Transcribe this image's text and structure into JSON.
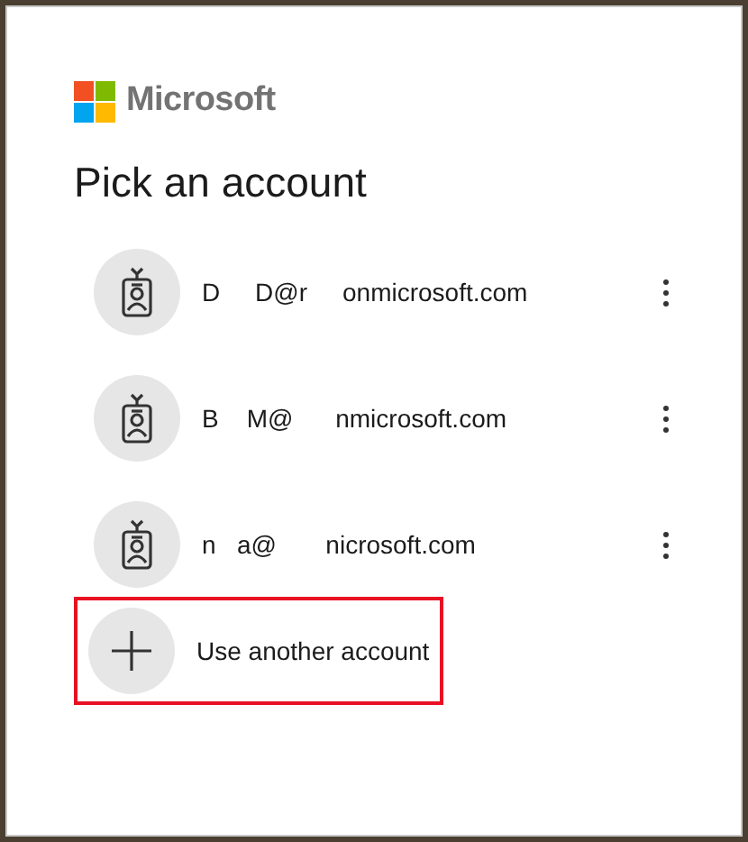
{
  "brand": {
    "name": "Microsoft"
  },
  "title": "Pick an account",
  "accounts": [
    {
      "email": "D     D@r     onmicrosoft.com"
    },
    {
      "email": "B    M@      nmicrosoft.com"
    },
    {
      "email": "n   a@       nicrosoft.com"
    }
  ],
  "add_account": {
    "label": "Use another account",
    "highlighted": true
  }
}
